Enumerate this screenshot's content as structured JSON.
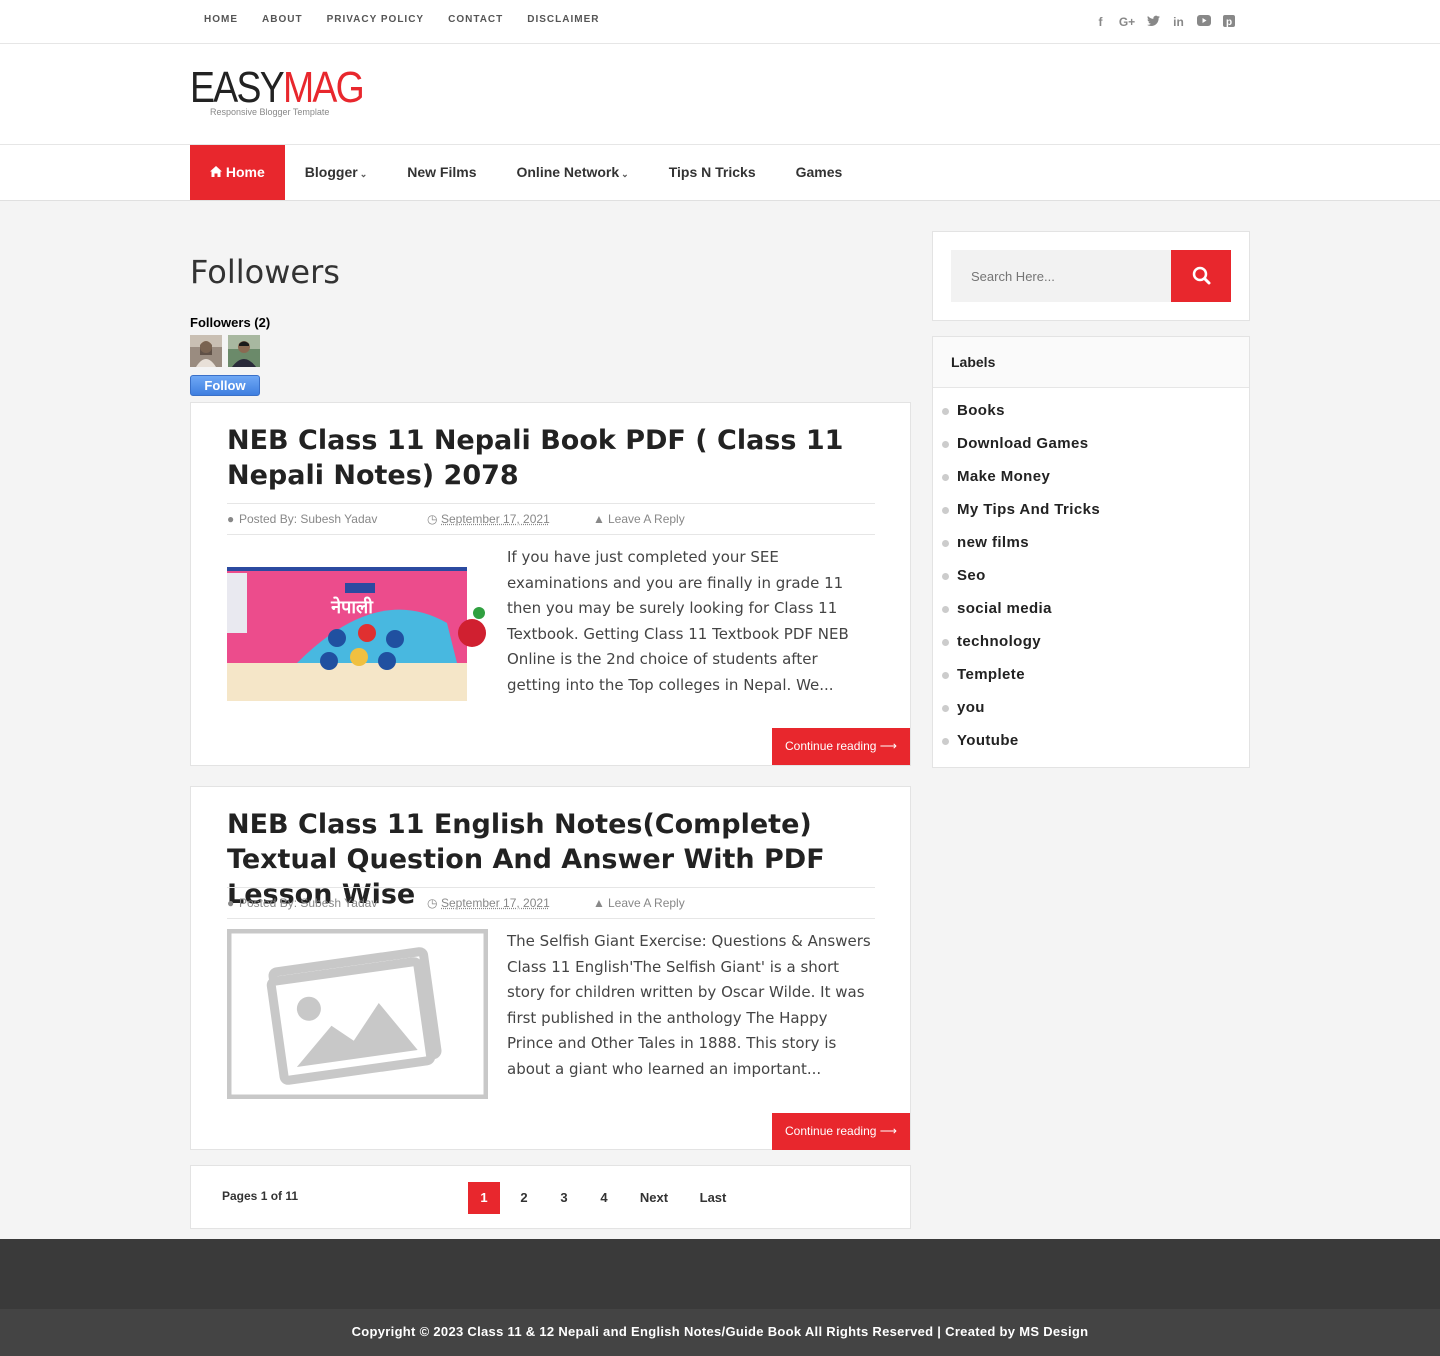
{
  "topnav": [
    "HOME",
    "ABOUT",
    "PRIVACY POLICY",
    "CONTACT",
    "DISCLAIMER"
  ],
  "social_icons": [
    "facebook-icon",
    "google-plus-icon",
    "twitter-icon",
    "linkedin-icon",
    "youtube-icon",
    "pinterest-icon"
  ],
  "logo": {
    "part1": "EASY",
    "part2": "MAG",
    "tagline": "Responsive Blogger Template"
  },
  "mainnav": [
    {
      "label": "Home",
      "active": true
    },
    {
      "label": "Blogger",
      "dropdown": true
    },
    {
      "label": "New Films"
    },
    {
      "label": "Online Network",
      "dropdown": true
    },
    {
      "label": "Tips N Tricks"
    },
    {
      "label": "Games"
    }
  ],
  "page_title": "Followers",
  "followers": {
    "title": "Followers (2)",
    "follow_label": "Follow"
  },
  "posts": [
    {
      "title": "NEB Class 11 Nepali Book PDF ( Class 11 Nepali Notes) 2078",
      "author": "Posted By: Subesh Yadav",
      "date": "September 17, 2021",
      "reply": "Leave A Reply",
      "excerpt": " If you have just completed your SEE examinations and you are finally in grade 11 then you may be surely looking for Class 11 Textbook. Getting Class 11 Textbook PDF NEB  Online is the 2nd choice of students after getting into the Top colleges in Nepal. We...",
      "thumb_text": "नेपाली",
      "continue": "Continue reading"
    },
    {
      "title": "NEB Class 11 English Notes(Complete) Textual Question And Answer With PDF Lesson Wise",
      "author": "Posted By: Subesh Yadav",
      "date": "September 17, 2021",
      "reply": "Leave A Reply",
      "excerpt": "The Selfish Giant Exercise: Questions & Answers Class 11 English'The Selfish Giant' is a short story for children written by Oscar Wilde. It was first published in the anthology The Happy Prince and Other Tales in 1888. This story is about a giant who learned an important...",
      "continue": "Continue reading"
    }
  ],
  "pagination": {
    "label": "Pages 1 of 11",
    "pages": [
      "1",
      "2",
      "3",
      "4"
    ],
    "next": "Next",
    "last": "Last"
  },
  "search": {
    "placeholder": "Search Here..."
  },
  "labels": {
    "title": "Labels",
    "items": [
      "Books",
      "Download Games",
      "Make Money",
      "My Tips And Tricks",
      "new films",
      "Seo",
      "social media",
      "technology",
      "Templete",
      "you",
      "Youtube"
    ]
  },
  "footer": {
    "copyright": "Copyright © 2023 Class 11 & 12 Nepali and English Notes/Guide Book All Rights Reserved | Created by MS Design"
  },
  "colors": {
    "accent": "#e8272d",
    "footer_dark": "#3a3a3a"
  }
}
